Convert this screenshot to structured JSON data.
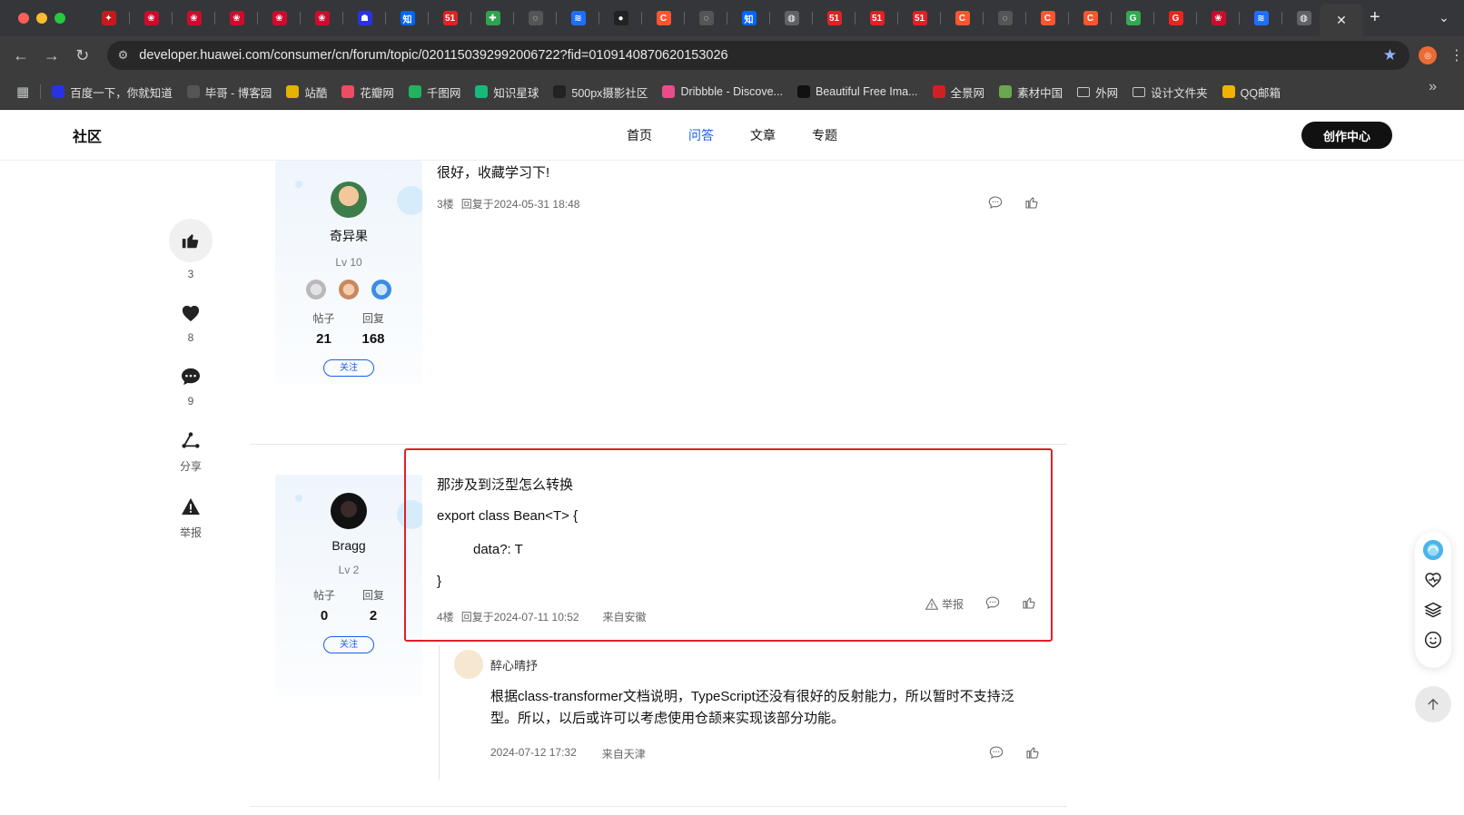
{
  "browser": {
    "tabs": [
      {
        "icon": "gitee-icon",
        "color": "#c7191c",
        "glyph": "✦"
      },
      {
        "icon": "huawei-icon",
        "color": "#cf0a2c",
        "glyph": "❀"
      },
      {
        "icon": "huawei-icon",
        "color": "#cf0a2c",
        "glyph": "❀"
      },
      {
        "icon": "huawei-icon",
        "color": "#cf0a2c",
        "glyph": "❀"
      },
      {
        "icon": "huawei-icon",
        "color": "#cf0a2c",
        "glyph": "❀"
      },
      {
        "icon": "huawei-icon",
        "color": "#cf0a2c",
        "glyph": "❀"
      },
      {
        "icon": "baidu-icon",
        "color": "#2932e1",
        "glyph": "☗"
      },
      {
        "icon": "zhihu-icon",
        "color": "#0066ff",
        "glyph": "知"
      },
      {
        "icon": "51cto-icon",
        "color": "#e81e25",
        "glyph": "51"
      },
      {
        "icon": "pinwheel-icon",
        "color": "#2ea44f",
        "glyph": "✚"
      },
      {
        "icon": "loading-icon",
        "color": "#555",
        "glyph": "◌"
      },
      {
        "icon": "blue-stack-icon",
        "color": "#1e6fff",
        "glyph": "≋"
      },
      {
        "icon": "github-icon",
        "color": "#222",
        "glyph": "●"
      },
      {
        "icon": "csdn-icon",
        "color": "#fc5531",
        "glyph": "C"
      },
      {
        "icon": "loading-icon",
        "color": "#555",
        "glyph": "◌"
      },
      {
        "icon": "zhihu-icon",
        "color": "#0066ff",
        "glyph": "知"
      },
      {
        "icon": "globe-icon",
        "color": "#5f6368",
        "glyph": "◍"
      },
      {
        "icon": "51cto-icon",
        "color": "#e81e25",
        "glyph": "51"
      },
      {
        "icon": "51cto-icon",
        "color": "#e81e25",
        "glyph": "51"
      },
      {
        "icon": "51cto-icon",
        "color": "#e81e25",
        "glyph": "51"
      },
      {
        "icon": "csdn-icon",
        "color": "#fc5531",
        "glyph": "C"
      },
      {
        "icon": "loading-icon",
        "color": "#555",
        "glyph": "◌"
      },
      {
        "icon": "csdn-icon",
        "color": "#fc5531",
        "glyph": "C"
      },
      {
        "icon": "csdn-icon",
        "color": "#fc5531",
        "glyph": "C"
      },
      {
        "icon": "google-icon",
        "color": "#34a853",
        "glyph": "G"
      },
      {
        "icon": "g-red-icon",
        "color": "#e8251e",
        "glyph": "G"
      },
      {
        "icon": "huawei-icon",
        "color": "#cf0a2c",
        "glyph": "❀"
      },
      {
        "icon": "blue-stack-icon",
        "color": "#1e6fff",
        "glyph": "≋"
      },
      {
        "icon": "globe-icon",
        "color": "#5f6368",
        "glyph": "◍"
      }
    ],
    "url": "developer.huawei.com/consumer/cn/forum/topic/0201150392992006722?fid=0109140870620153026",
    "bookmarks": [
      {
        "label": "百度一下，你就知道",
        "color": "#2932e1"
      },
      {
        "label": "毕哥 - 博客园",
        "color": "#555"
      },
      {
        "label": "站酷",
        "color": "#e2b400"
      },
      {
        "label": "花瓣网",
        "color": "#ee4c64"
      },
      {
        "label": "千图网",
        "color": "#21b35f"
      },
      {
        "label": "知识星球",
        "color": "#16b97a"
      },
      {
        "label": "500px摄影社区",
        "color": "#222"
      },
      {
        "label": "Dribbble - Discove...",
        "color": "#ea4c89"
      },
      {
        "label": "Beautiful Free Ima...",
        "color": "#111"
      },
      {
        "label": "全景网",
        "color": "#d21f26"
      },
      {
        "label": "素材中国",
        "color": "#6aa84f"
      },
      {
        "label": "外网",
        "color": "folder"
      },
      {
        "label": "设计文件夹",
        "color": "folder"
      },
      {
        "label": "QQ邮箱",
        "color": "#f0b400"
      }
    ]
  },
  "site": {
    "brand": "社区",
    "nav": [
      "首页",
      "问答",
      "文章",
      "专题"
    ],
    "create_label": "创作中心"
  },
  "leftbar": {
    "like_count": "3",
    "fav_count": "8",
    "comment_count": "9",
    "share_label": "分享",
    "report_label": "举报"
  },
  "posts": [
    {
      "user": {
        "name": "奇异果",
        "level": "Lv 10",
        "posts_label": "帖子",
        "posts": "21",
        "replies_label": "回复",
        "replies": "168",
        "follow": "关注"
      },
      "text": "很好，收藏学习下!",
      "floor": "3楼",
      "time": "回复于2024-05-31 18:48"
    },
    {
      "user": {
        "name": "Bragg",
        "level": "Lv 2",
        "posts_label": "帖子",
        "posts": "0",
        "replies_label": "回复",
        "replies": "2",
        "follow": "关注"
      },
      "lines": [
        "那涉及到泛型怎么转换",
        "export class Bean<T> {",
        "data?: T",
        "}"
      ],
      "floor": "4楼",
      "time": "回复于2024-07-11 10:52",
      "location": "来自安徽",
      "report": "举报"
    }
  ],
  "reply": {
    "name": "醉心晴抒",
    "text": "根据class-transformer文档说明，TypeScript还没有很好的反射能力，所以暂时不支持泛型。所以，以后或许可以考虑使用仓颉来实现该部分功能。",
    "time": "2024-07-12 17:32",
    "location": "来自天津"
  }
}
